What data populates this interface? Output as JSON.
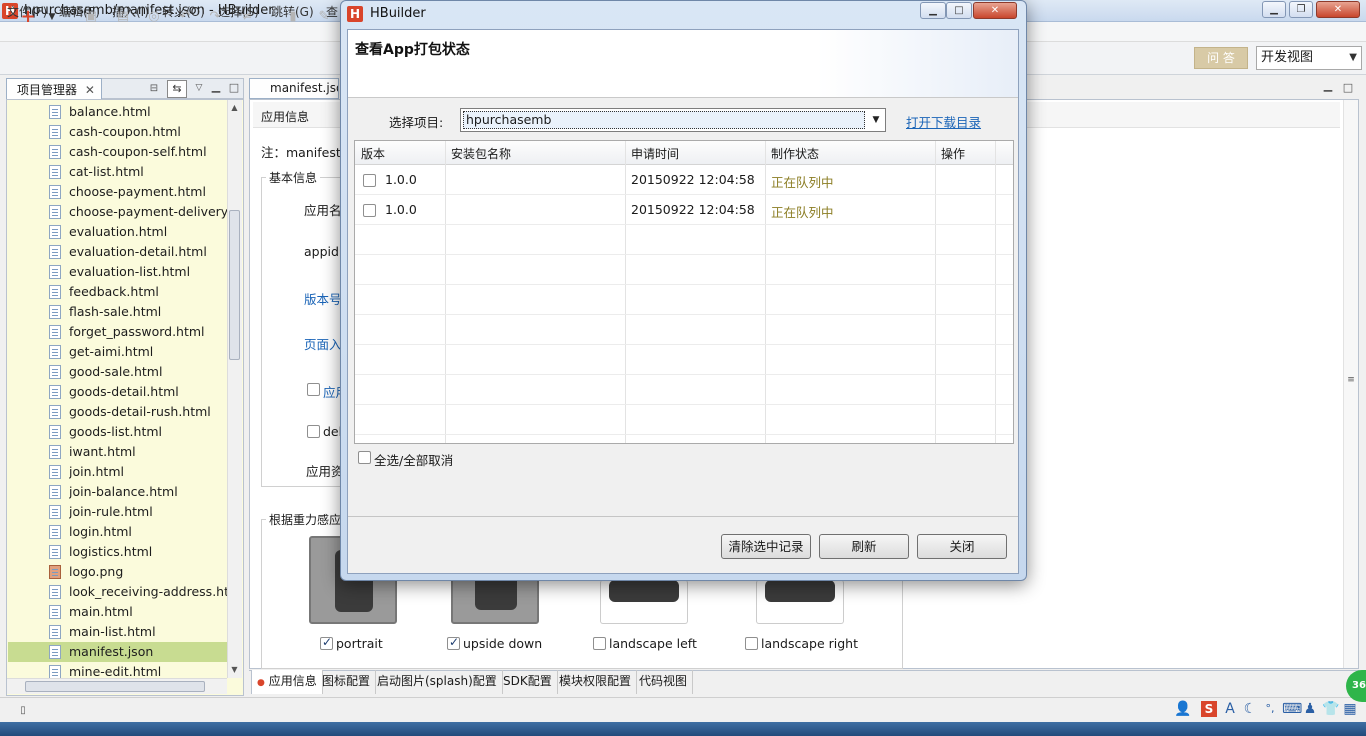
{
  "window": {
    "title": "hpurchasemb/manifest.json - HBuilder",
    "logo_letter": "H"
  },
  "menu": [
    "文件(F)",
    "编辑(E)",
    "插入(I)",
    "转义(O)",
    "选择(S)",
    "跳转(G)",
    "查"
  ],
  "toolbar": {
    "ask_label": "问 答",
    "view_select": "开发视图"
  },
  "project_panel": {
    "tab_label": "项目管理器",
    "files": [
      {
        "name": "balance.html",
        "type": "html"
      },
      {
        "name": "cash-coupon.html",
        "type": "html"
      },
      {
        "name": "cash-coupon-self.html",
        "type": "html"
      },
      {
        "name": "cat-list.html",
        "type": "html"
      },
      {
        "name": "choose-payment.html",
        "type": "html"
      },
      {
        "name": "choose-payment-delivery.h",
        "type": "html"
      },
      {
        "name": "evaluation.html",
        "type": "html"
      },
      {
        "name": "evaluation-detail.html",
        "type": "html"
      },
      {
        "name": "evaluation-list.html",
        "type": "html"
      },
      {
        "name": "feedback.html",
        "type": "html"
      },
      {
        "name": "flash-sale.html",
        "type": "html"
      },
      {
        "name": "forget_password.html",
        "type": "html"
      },
      {
        "name": "get-aimi.html",
        "type": "html"
      },
      {
        "name": "good-sale.html",
        "type": "html"
      },
      {
        "name": "goods-detail.html",
        "type": "html"
      },
      {
        "name": "goods-detail-rush.html",
        "type": "html"
      },
      {
        "name": "goods-list.html",
        "type": "html"
      },
      {
        "name": "iwant.html",
        "type": "html"
      },
      {
        "name": "join.html",
        "type": "html"
      },
      {
        "name": "join-balance.html",
        "type": "html"
      },
      {
        "name": "join-rule.html",
        "type": "html"
      },
      {
        "name": "login.html",
        "type": "html"
      },
      {
        "name": "logistics.html",
        "type": "html"
      },
      {
        "name": "logo.png",
        "type": "image"
      },
      {
        "name": "look_receiving-address.htm",
        "type": "html"
      },
      {
        "name": "main.html",
        "type": "html"
      },
      {
        "name": "main-list.html",
        "type": "html"
      },
      {
        "name": "manifest.json",
        "type": "json",
        "selected": true
      },
      {
        "name": "mine-edit.html",
        "type": "html"
      }
    ]
  },
  "editor": {
    "tab_label": "manifest.json",
    "section_title": "应用信息",
    "note": "注：manifest里",
    "basic_group": "基本信息",
    "fields": [
      "应用名",
      "appid:",
      "版本号",
      "页面入",
      "应用",
      "deb",
      "应用资"
    ],
    "gravity_group": "根据重力感应",
    "orientations": [
      {
        "label": "portrait",
        "checked": true
      },
      {
        "label": "upside down",
        "checked": true
      },
      {
        "label": "landscape left",
        "checked": false
      },
      {
        "label": "landscape right",
        "checked": false
      }
    ],
    "bottom_tabs": [
      "应用信息",
      "图标配置",
      "启动图片(splash)配置",
      "SDK配置",
      "模块权限配置",
      "代码视图"
    ]
  },
  "dialog": {
    "title": "HBuilder",
    "heading": "查看App打包状态",
    "select_label": "选择项目:",
    "selected_project": "hpurchasemb",
    "open_download_link": "打开下载目录",
    "columns": [
      "版本",
      "安装包名称",
      "申请时间",
      "制作状态",
      "操作"
    ],
    "rows": [
      {
        "version": "1.0.0",
        "package": "",
        "time": "20150922 12:04:58",
        "status": "正在队列中",
        "action": ""
      },
      {
        "version": "1.0.0",
        "package": "",
        "time": "20150922 12:04:58",
        "status": "正在队列中",
        "action": ""
      }
    ],
    "select_all_label": "全选/全部取消",
    "buttons": {
      "clear": "清除选中记录",
      "refresh": "刷新",
      "close": "关闭"
    }
  },
  "status": {
    "badge": "36"
  }
}
